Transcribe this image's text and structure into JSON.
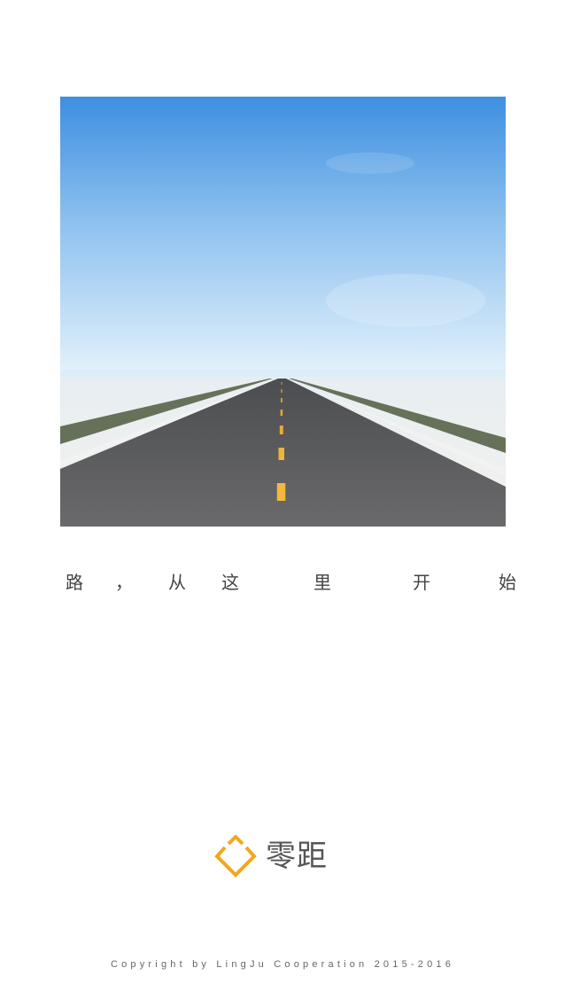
{
  "hero": {
    "image_name": "open-road-photo"
  },
  "tagline": {
    "chars": [
      "路",
      "，",
      "从",
      "这",
      "里",
      "开",
      "始"
    ]
  },
  "logo": {
    "icon_name": "diamond-logo-icon",
    "text": "零距",
    "accent_color": "#F2A81D"
  },
  "footer": {
    "copyright": "Copyright by LingJu Cooperation 2015-2016"
  }
}
